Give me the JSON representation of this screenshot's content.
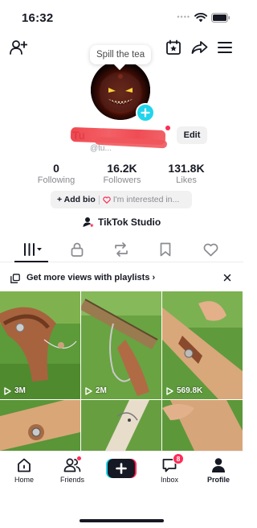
{
  "status_bar": {
    "time": "16:32"
  },
  "header": {
    "tooltip": "Spill the tea"
  },
  "profile": {
    "username": "Tu",
    "handle": "@tu...",
    "edit_label": "Edit"
  },
  "stats": [
    {
      "value": "0",
      "label": "Following"
    },
    {
      "value": "16.2K",
      "label": "Followers"
    },
    {
      "value": "131.8K",
      "label": "Likes"
    }
  ],
  "bio": {
    "add_label": "+ Add bio",
    "interest_label": "I'm interested in..."
  },
  "studio": {
    "label": "TikTok Studio"
  },
  "banner": {
    "text": "Get more views with playlists ›"
  },
  "videos": [
    {
      "views": "3M"
    },
    {
      "views": "2M"
    },
    {
      "views": "569.8K"
    },
    {
      "views": ""
    },
    {
      "views": ""
    },
    {
      "views": ""
    }
  ],
  "nav": {
    "home": "Home",
    "friends": "Friends",
    "inbox": "Inbox",
    "inbox_badge": "8",
    "profile": "Profile"
  },
  "colors": {
    "accent_red": "#fe2c55",
    "accent_cyan": "#20d5ec",
    "text": "#161823"
  }
}
